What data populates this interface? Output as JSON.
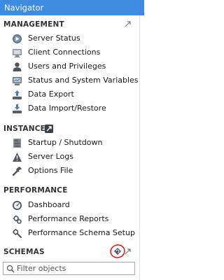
{
  "navigator": {
    "title": "Navigator"
  },
  "management": {
    "header": "MANAGEMENT",
    "items": [
      {
        "label": "Server Status",
        "icon": "server-status-icon"
      },
      {
        "label": "Client Connections",
        "icon": "client-connections-icon"
      },
      {
        "label": "Users and Privileges",
        "icon": "user-icon"
      },
      {
        "label": "Status and System Variables",
        "icon": "system-variables-icon"
      },
      {
        "label": "Data Export",
        "icon": "data-export-icon"
      },
      {
        "label": "Data Import/Restore",
        "icon": "data-import-icon"
      }
    ]
  },
  "instance": {
    "header": "INSTANCE",
    "items": [
      {
        "label": "Startup / Shutdown",
        "icon": "startup-shutdown-icon"
      },
      {
        "label": "Server Logs",
        "icon": "warning-icon"
      },
      {
        "label": "Options File",
        "icon": "wrench-icon"
      }
    ]
  },
  "performance": {
    "header": "PERFORMANCE",
    "items": [
      {
        "label": "Dashboard",
        "icon": "dashboard-icon"
      },
      {
        "label": "Performance Reports",
        "icon": "performance-reports-icon"
      },
      {
        "label": "Performance Schema Setup",
        "icon": "schema-setup-icon"
      }
    ]
  },
  "schemas": {
    "header": "SCHEMAS",
    "filter_placeholder": "Filter objects",
    "annotation_color": "#e01515"
  },
  "colors": {
    "titlebar": "#3c8be0",
    "icon_blue": "#4a7fbf",
    "icon_gray": "#666666"
  }
}
